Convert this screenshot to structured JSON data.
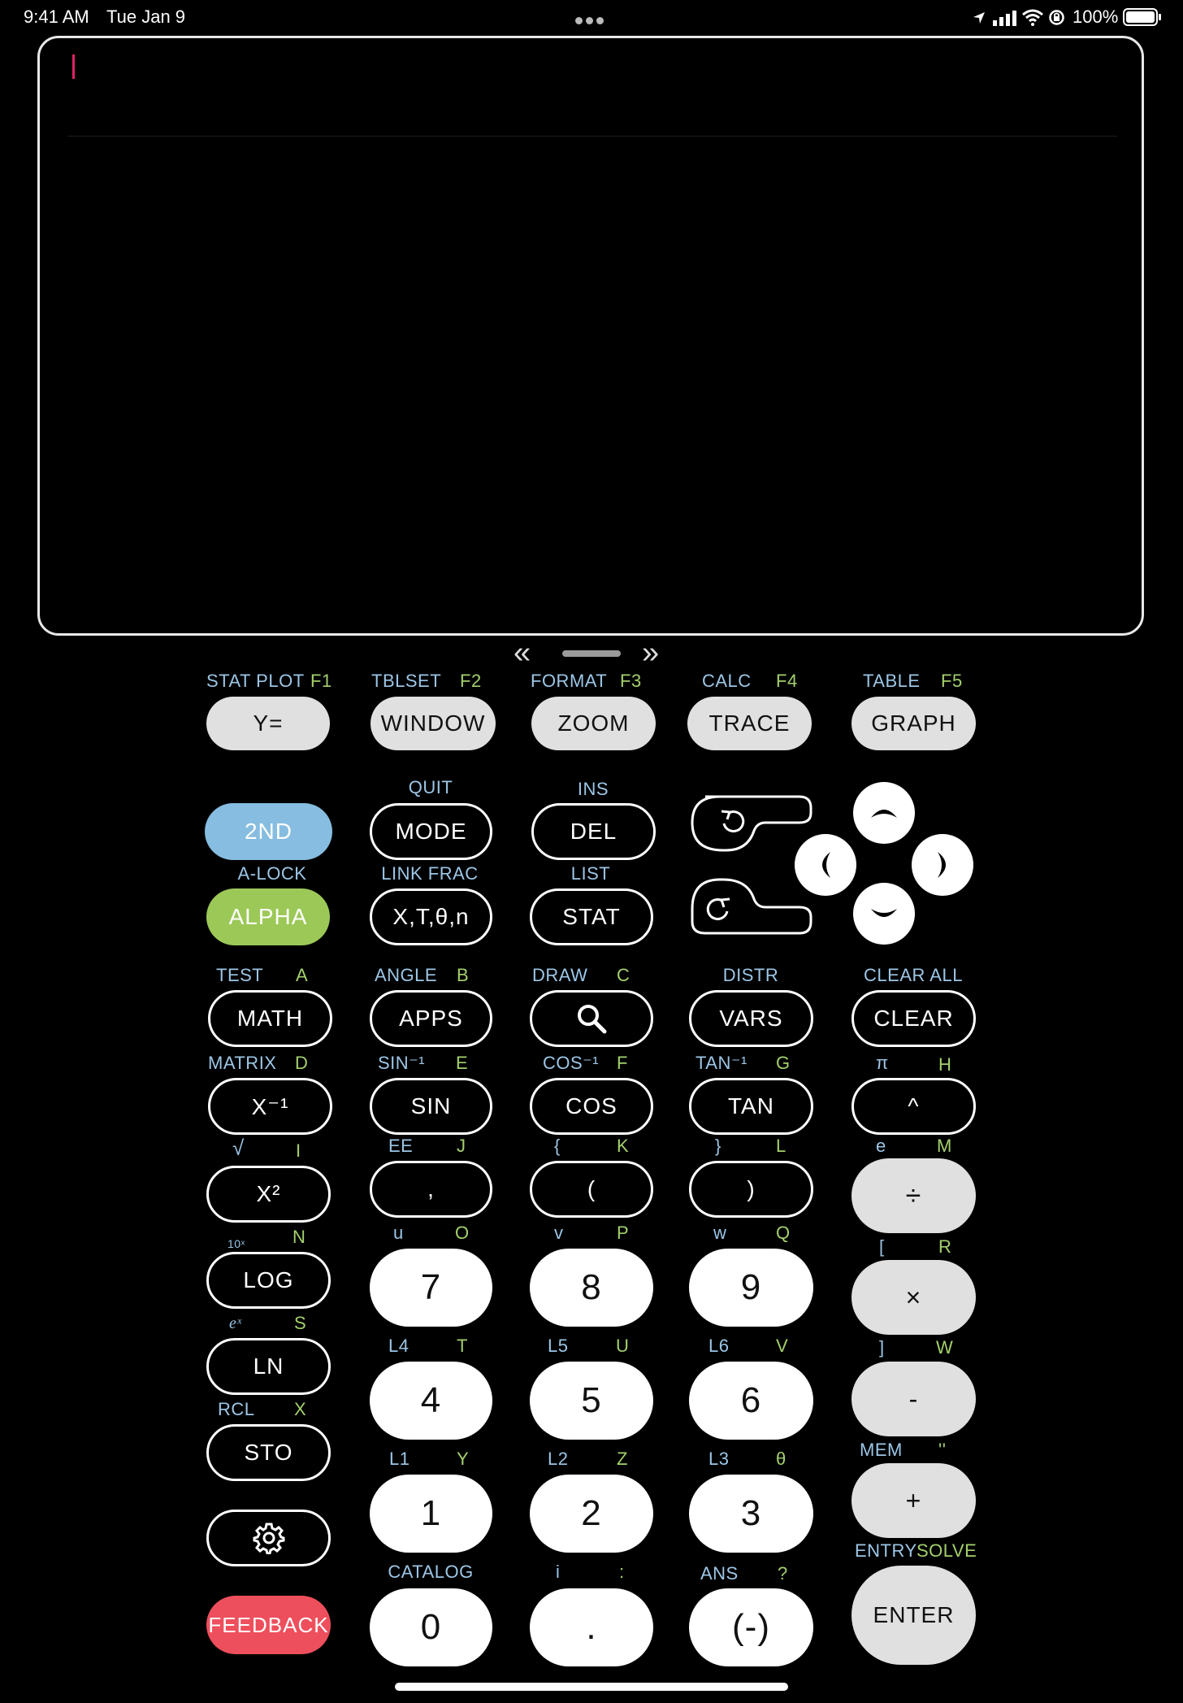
{
  "status_bar": {
    "time": "9:41 AM",
    "date": "Tue Jan 9",
    "battery": "100%",
    "icons": [
      "location-icon",
      "cellular-signal-icon",
      "wifi-icon",
      "orientation-lock-icon",
      "battery-icon"
    ]
  },
  "pager": {
    "prev": "«",
    "next": "»"
  },
  "colors": {
    "second_fn": "#9cc6e6",
    "alpha_fn": "#a4d06c",
    "second_key": "#86bde0",
    "alpha_key": "#9cc858",
    "feedback_key": "#ee4f5d",
    "light_key": "#e0e0e0",
    "cursor": "#e0226a"
  },
  "rows": {
    "r1": {
      "labels": {
        "stat_plot": "STAT PLOT",
        "f1": "F1",
        "tblset": "TBLSET",
        "f2": "F2",
        "format": "FORMAT",
        "f3": "F3",
        "calc": "CALC",
        "f4": "F4",
        "table": "TABLE",
        "f5": "F5"
      },
      "keys": {
        "y_equals": "Y=",
        "window": "WINDOW",
        "zoom": "ZOOM",
        "trace": "TRACE",
        "graph": "GRAPH"
      }
    },
    "r2": {
      "labels": {
        "quit": "QUIT",
        "ins": "INS"
      },
      "keys": {
        "second": "2ND",
        "mode": "MODE",
        "del": "DEL"
      }
    },
    "r3": {
      "labels": {
        "a_lock": "A-LOCK",
        "link_frac": "LINK FRAC",
        "list": "LIST"
      },
      "keys": {
        "alpha": "ALPHA",
        "xtn": "X,T,θ,n",
        "stat": "STAT"
      }
    },
    "r4": {
      "labels": {
        "test": "TEST",
        "a": "A",
        "angle": "ANGLE",
        "b": "B",
        "draw": "DRAW",
        "c": "C",
        "distr": "DISTR",
        "clear_all": "CLEAR ALL"
      },
      "keys": {
        "math": "MATH",
        "apps": "APPS",
        "vars": "VARS",
        "clear": "CLEAR"
      }
    },
    "r5": {
      "labels": {
        "matrix": "MATRIX",
        "d": "D",
        "sin_inv": "SIN⁻¹",
        "e": "E",
        "cos_inv": "COS⁻¹",
        "f": "F",
        "tan_inv": "TAN⁻¹",
        "g": "G",
        "pi": "π",
        "h": "H"
      },
      "keys": {
        "x_inv": "X⁻¹",
        "sin": "SIN",
        "cos": "COS",
        "tan": "TAN",
        "caret": "^"
      }
    },
    "r6": {
      "labels": {
        "sqrt": "√",
        "i": "I",
        "ee": "EE",
        "j": "J",
        "lbrace": "{",
        "k": "K",
        "rbrace": "}",
        "l": "L",
        "e_const": "e",
        "m": "M"
      },
      "keys": {
        "x_sq": "X²",
        "comma": ",",
        "lparen": "(",
        "rparen": ")",
        "divide": "÷"
      }
    },
    "r7": {
      "labels": {
        "ten_x": "10ˣ",
        "n": "N",
        "u": "u",
        "o": "O",
        "v": "v",
        "p": "P",
        "w_lower": "w",
        "q": "Q",
        "lbracket": "[",
        "r": "R"
      },
      "keys": {
        "log": "LOG",
        "seven": "7",
        "eight": "8",
        "nine": "9",
        "times": "×"
      }
    },
    "r8": {
      "labels": {
        "e_x": "eˣ",
        "s": "S",
        "l4": "L4",
        "t": "T",
        "l5": "L5",
        "u_upper": "U",
        "l6": "L6",
        "v_upper": "V",
        "rbracket": "]",
        "w_upper": "W"
      },
      "keys": {
        "ln": "LN",
        "four": "4",
        "five": "5",
        "six": "6",
        "minus": "-"
      }
    },
    "r9": {
      "labels": {
        "rcl": "RCL",
        "x": "X",
        "l1": "L1",
        "y": "Y",
        "l2": "L2",
        "z": "Z",
        "l3": "L3",
        "theta": "θ",
        "mem": "MEM",
        "quote": "''"
      },
      "keys": {
        "sto": "STO",
        "one": "1",
        "two": "2",
        "three": "3",
        "plus": "+"
      }
    },
    "r10": {
      "labels": {
        "catalog": "CATALOG",
        "i_lower": "i",
        "colon": ":",
        "ans": "ANS",
        "question": "?",
        "entry": "ENTRY",
        "solve": "SOLVE"
      },
      "keys": {
        "feedback": "FEEDBACK",
        "zero": "0",
        "dot": ".",
        "negate": "(-)",
        "enter": "ENTER"
      }
    }
  }
}
